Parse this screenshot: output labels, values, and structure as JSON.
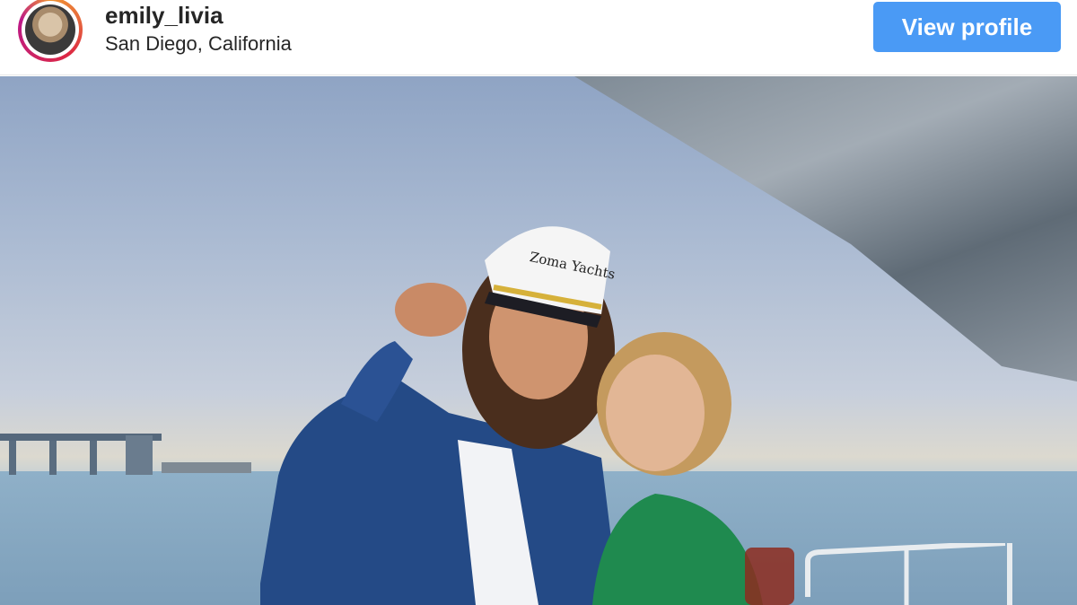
{
  "header": {
    "username": "emily_livia",
    "location": "San Diego, California",
    "view_profile_label": "View profile"
  },
  "photo": {
    "hat_text": "Zoma Yachts"
  },
  "colors": {
    "button_bg": "#4a9af5",
    "text": "#262626"
  }
}
